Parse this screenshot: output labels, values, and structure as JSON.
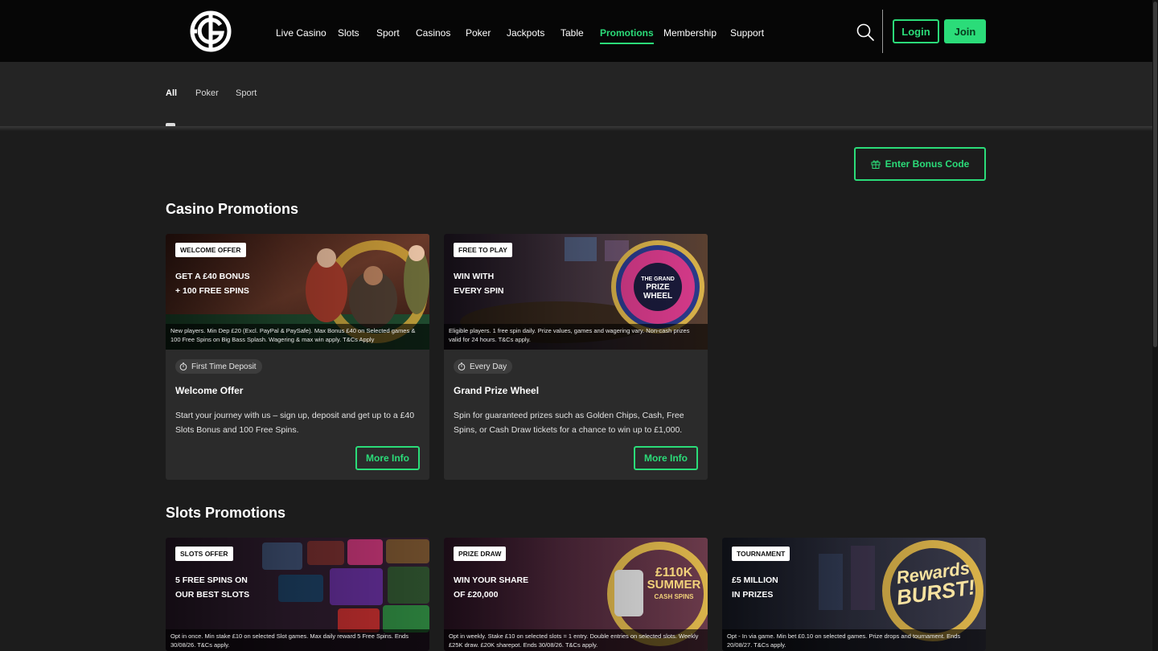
{
  "header": {
    "logo_letter": "G",
    "nav": [
      {
        "label": "Live Casino"
      },
      {
        "label": "Slots"
      },
      {
        "label": "Sport"
      },
      {
        "label": "Casinos"
      },
      {
        "label": "Poker"
      },
      {
        "label": "Jackpots"
      },
      {
        "label": "Table"
      },
      {
        "label": "Promotions",
        "active": true
      },
      {
        "label": "Membership"
      },
      {
        "label": "Support"
      }
    ],
    "login_label": "Login",
    "join_label": "Join"
  },
  "filters": [
    {
      "label": "All",
      "active": true
    },
    {
      "label": "Poker"
    },
    {
      "label": "Sport"
    }
  ],
  "bonus_button_label": "Enter Bonus Code",
  "sections": [
    {
      "title": "Casino Promotions",
      "cards": [
        {
          "tag": "WELCOME OFFER",
          "headline_1": "GET A £40 BONUS",
          "headline_2": "+ 100 FREE SPINS",
          "terms": "New players. Min Dep £20 (Excl. PayPal & PaySafe). Max Bonus £40 on Selected games & 100 Free Spins on Big Bass Splash. Wagering & max win apply. T&Cs Apply",
          "pill": "First Time Deposit",
          "title": "Welcome Offer",
          "desc": "Start your journey with us – sign up, deposit and get up to a £40 Slots Bonus and 100 Free Spins.",
          "button": "More Info"
        },
        {
          "tag": "FREE TO PLAY",
          "headline_1": "WIN WITH",
          "headline_2": "EVERY SPIN",
          "terms": "Eligible players. 1 free spin daily. Prize values, games and wagering vary. Non-cash prizes valid for 24 hours. T&Cs apply.",
          "pill": "Every Day",
          "title": "Grand Prize Wheel",
          "desc": "Spin for guaranteed prizes such as Golden Chips, Cash, Free Spins, or Cash Draw tickets for a chance to win up to £1,000.",
          "button": "More Info",
          "art_text_1": "THE GRAND",
          "art_text_2": "PRIZE",
          "art_text_3": "WHEEL"
        }
      ]
    },
    {
      "title": "Slots Promotions",
      "cards": [
        {
          "tag": "SLOTS OFFER",
          "headline_1": "5 FREE SPINS ON",
          "headline_2": "OUR BEST SLOTS",
          "terms": "Opt in once. Min stake £10 on selected Slot games. Max daily reward 5 Free Spins. Ends 30/08/26. T&Cs apply."
        },
        {
          "tag": "PRIZE DRAW",
          "headline_1": "WIN YOUR SHARE",
          "headline_2": "OF £20,000",
          "terms": "Opt in weekly. Stake £10 on selected slots = 1 entry. Double entries on selected slots. Weekly £25K draw. £20K sharepot. Ends 30/08/26. T&Cs apply.",
          "art_text_1": "£110K",
          "art_text_2": "SUMMER",
          "art_text_3": "CASH SPINS"
        },
        {
          "tag": "TOURNAMENT",
          "headline_1": "£5 MILLION",
          "headline_2": "IN PRIZES",
          "terms": "Opt - In via game. Min bet £0.10 on selected games. Prize drops and tournament. Ends 20/08/27. T&Cs apply.",
          "art_text_1": "Rewards",
          "art_text_2": "BURST!"
        }
      ]
    }
  ],
  "colors": {
    "accent": "#2bdc79",
    "header_bg": "#060606",
    "page_bg": "#1c1c1c",
    "card_bg": "#2b2b2b"
  }
}
